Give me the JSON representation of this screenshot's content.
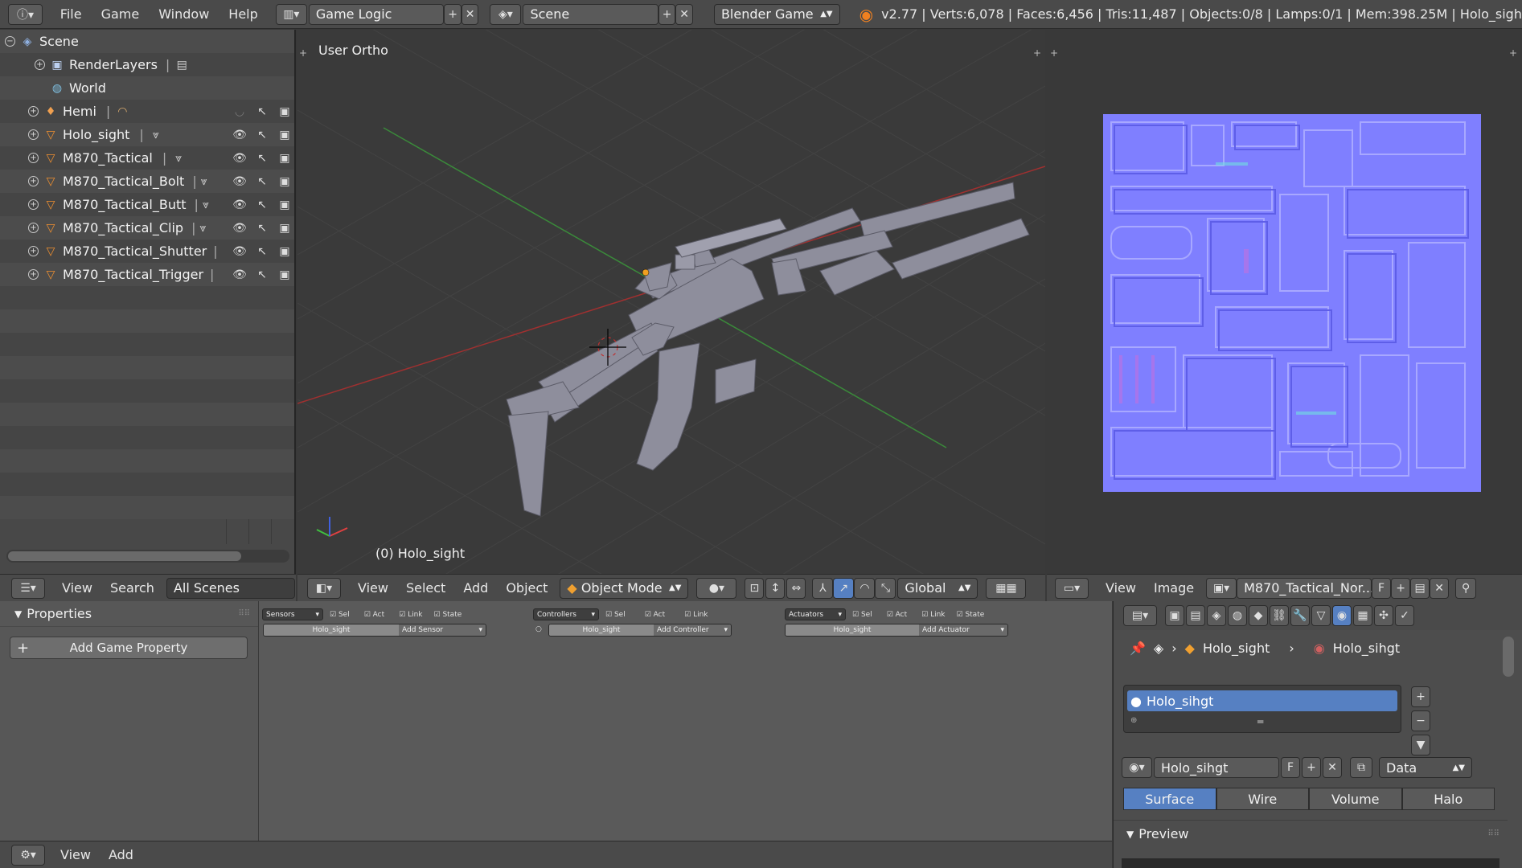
{
  "topbar": {
    "menus": [
      "File",
      "Game",
      "Window",
      "Help"
    ],
    "screen_layout": "Game Logic",
    "scene": "Scene",
    "engine": "Blender Game",
    "stats": "v2.77 | Verts:6,078 | Faces:6,456 | Tris:11,487 | Objects:0/8 | Lamps:0/1 | Mem:398.25M | Holo_sigh"
  },
  "outliner": {
    "items": [
      {
        "label": "Scene",
        "icon": "scene-icon"
      },
      {
        "label": "RenderLayers",
        "icon": "render-layers-icon"
      },
      {
        "label": "World",
        "icon": "world-icon"
      },
      {
        "label": "Hemi",
        "icon": "lamp-icon"
      },
      {
        "label": "Holo_sight",
        "icon": "mesh-object-icon"
      },
      {
        "label": "M870_Tactical",
        "icon": "mesh-object-icon"
      },
      {
        "label": "M870_Tactical_Bolt",
        "icon": "mesh-object-icon"
      },
      {
        "label": "M870_Tactical_Butt",
        "icon": "mesh-object-icon"
      },
      {
        "label": "M870_Tactical_Clip",
        "icon": "mesh-object-icon"
      },
      {
        "label": "M870_Tactical_Shutter",
        "icon": "mesh-object-icon"
      },
      {
        "label": "M870_Tactical_Trigger",
        "icon": "mesh-object-icon"
      }
    ],
    "header": {
      "view": "View",
      "search": "Search",
      "filter": "All Scenes"
    }
  },
  "viewport": {
    "view_label": "User Ortho",
    "object_label": "(0) Holo_sight",
    "header": {
      "menus": [
        "View",
        "Select",
        "Add",
        "Object"
      ],
      "mode": "Object Mode",
      "orientation": "Global"
    }
  },
  "image_editor": {
    "header": {
      "menus": [
        "View",
        "Image"
      ],
      "image_name": "M870_Tactical_Nor...",
      "fake_user": "F"
    }
  },
  "logic": {
    "properties_title": "Properties",
    "add_property": "Add Game Property",
    "sensors": {
      "title": "Sensors",
      "object": "Holo_sight",
      "add": "Add Sensor",
      "checks": [
        "Sel",
        "Act",
        "Link",
        "State"
      ]
    },
    "controllers": {
      "title": "Controllers",
      "object": "Holo_sight",
      "add": "Add Controller",
      "checks": [
        "Sel",
        "Act",
        "Link"
      ]
    },
    "actuators": {
      "title": "Actuators",
      "object": "Holo_sight",
      "add": "Add Actuator",
      "checks": [
        "Sel",
        "Act",
        "Link",
        "State"
      ]
    },
    "header": {
      "menus": [
        "View",
        "Add"
      ]
    }
  },
  "properties": {
    "breadcrumb": {
      "object": "Holo_sight",
      "material": "Holo_sihgt"
    },
    "slot": "Holo_sihgt",
    "material_name": "Holo_sihgt",
    "fake_user": "F",
    "link": "Data",
    "tabs": [
      "Surface",
      "Wire",
      "Volume",
      "Halo"
    ],
    "active_tab": "Surface",
    "preview": "Preview"
  },
  "colors": {
    "accent": "#5680c2",
    "normal_map": "#7f7fff",
    "header": "#4a4a4a"
  }
}
